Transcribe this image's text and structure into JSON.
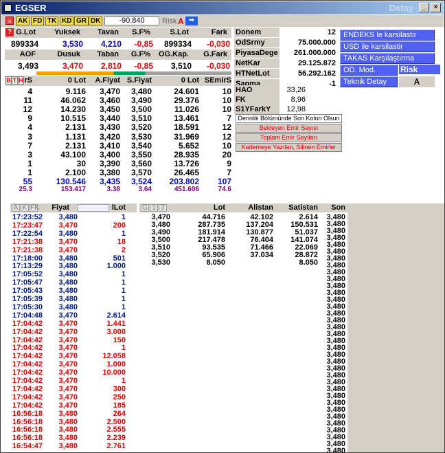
{
  "title": "EGSER",
  "title_right": "Detay",
  "toolbar": {
    "tags": [
      "AK",
      "FD",
      "TK",
      "KD",
      "GR",
      "DK"
    ],
    "value": "-90.840",
    "risk_label": "Risk",
    "risk_value": "A"
  },
  "summary": {
    "h1": [
      "G.Lot",
      "Yuksek",
      "Tavan",
      "S.F%",
      "S.Lot",
      "Fark"
    ],
    "v1": [
      "899334",
      "3,530",
      "4,210",
      "-0,85",
      "899334",
      "-0,030"
    ],
    "h2": [
      "AOF",
      "Dusuk",
      "Taban",
      "G.F%",
      "OG.Kap.",
      "G.Fark"
    ],
    "v2": [
      "3,493",
      "3,470",
      "2,810",
      "-0,85",
      "3,510",
      "-0,030"
    ]
  },
  "depth_headers": [
    "rS",
    "0 Lot",
    "A.Fiyat",
    "S.Fiyat",
    "0 Lot",
    "SEmirS"
  ],
  "depth_tabs": [
    "B",
    "T",
    "H"
  ],
  "depth": [
    [
      "4",
      "9.116",
      "3,470",
      "3,480",
      "24.601",
      "10"
    ],
    [
      "11",
      "46.062",
      "3,460",
      "3,490",
      "29.376",
      "10"
    ],
    [
      "12",
      "14.230",
      "3,450",
      "3,500",
      "11.026",
      "10"
    ],
    [
      "9",
      "10.515",
      "3,440",
      "3,510",
      "13.461",
      "7"
    ],
    [
      "4",
      "2.131",
      "3,430",
      "3,520",
      "18.591",
      "12"
    ],
    [
      "3",
      "1.131",
      "3,420",
      "3,530",
      "31.969",
      "12"
    ],
    [
      "7",
      "2.131",
      "3,410",
      "3,540",
      "5.652",
      "10"
    ],
    [
      "3",
      "43.100",
      "3,400",
      "3,550",
      "28.935",
      "20"
    ],
    [
      "1",
      "30",
      "3,390",
      "3,560",
      "13.726",
      "9"
    ],
    [
      "1",
      "2.100",
      "3,380",
      "3,570",
      "26.465",
      "7"
    ]
  ],
  "depth_total": [
    "55",
    "130.546",
    "3,435",
    "3,524",
    "203.802",
    "107"
  ],
  "depth_avg": [
    "25.3",
    "153.417",
    "3.38",
    "3.64",
    "451.606",
    "74.6"
  ],
  "info": [
    [
      "Donem",
      "12"
    ],
    [
      "OdSrmy",
      "75.000.000"
    ],
    [
      "PiyasaDege",
      "261.000.000"
    ],
    [
      "NetKar",
      "29.125.872"
    ],
    [
      "HTNetLot",
      "56.292.162"
    ],
    [
      "Sapma",
      "-1"
    ]
  ],
  "info2": [
    [
      "HAO",
      "33,26"
    ],
    [
      "FK",
      "8,96"
    ],
    [
      "S1YFarkY",
      "12,98"
    ]
  ],
  "buttons": [
    "ENDEKS le karsilastir",
    "USD ile karsilastir",
    "TAKAS Karşılaştırma",
    "OD. Mod.",
    "Teknik Detay"
  ],
  "risk_kodu_label": "Risk Kodu",
  "risk_kodu_value": "A",
  "menu": [
    "Derinlik Bölümünde Son Kolon Olsun",
    "Bekleyen Emir Sayısı",
    "Toplam Emir Sayıları",
    "Kademeye Yazılan, Silinen Emirler"
  ],
  "trades_header": {
    "tabs": [
      "A",
      "K",
      "FK"
    ],
    "fiyat": "Fiyat",
    "lot": "lLot"
  },
  "trades": [
    [
      "17:23:52",
      "3,480",
      "1",
      "b"
    ],
    [
      "17:23:47",
      "3,470",
      "200",
      "r"
    ],
    [
      "17:22:54",
      "3,480",
      "1",
      "b"
    ],
    [
      "17:21:38",
      "3,470",
      "18",
      "r"
    ],
    [
      "17:21:38",
      "3,470",
      "2",
      "r"
    ],
    [
      "17:18:00",
      "3,480",
      "501",
      "b"
    ],
    [
      "17:13:29",
      "3,480",
      "1.000",
      "b"
    ],
    [
      "17:05:52",
      "3,480",
      "1",
      "b"
    ],
    [
      "17:05:47",
      "3,480",
      "1",
      "b"
    ],
    [
      "17:05:43",
      "3,480",
      "1",
      "b"
    ],
    [
      "17:05:39",
      "3,480",
      "1",
      "b"
    ],
    [
      "17:05:30",
      "3,480",
      "1",
      "b"
    ],
    [
      "17:04:48",
      "3,470",
      "2.614",
      "b"
    ],
    [
      "17:04:42",
      "3,470",
      "1.441",
      "r"
    ],
    [
      "17:04:42",
      "3,470",
      "3.000",
      "r"
    ],
    [
      "17:04:42",
      "3,470",
      "150",
      "r"
    ],
    [
      "17:04:42",
      "3,470",
      "1",
      "r"
    ],
    [
      "17:04:42",
      "3,470",
      "12.058",
      "r"
    ],
    [
      "17:04:42",
      "3,470",
      "1.000",
      "r"
    ],
    [
      "17:04:42",
      "3,470",
      "10.000",
      "r"
    ],
    [
      "17:04:42",
      "3,470",
      "1",
      "r"
    ],
    [
      "17:04:42",
      "3,470",
      "300",
      "r"
    ],
    [
      "17:04:42",
      "3,470",
      "250",
      "r"
    ],
    [
      "17:04:42",
      "3,470",
      "185",
      "r"
    ],
    [
      "16:56:18",
      "3,480",
      "264",
      "r"
    ],
    [
      "16:56:18",
      "3,480",
      "2.500",
      "r"
    ],
    [
      "16:56:18",
      "3,480",
      "2.555",
      "r"
    ],
    [
      "16:56:18",
      "3,480",
      "2.239",
      "r"
    ],
    [
      "16:54:47",
      "3,480",
      "2.761",
      "r"
    ]
  ],
  "dist_header": {
    "tabs": [
      "G",
      "1",
      "2"
    ],
    "lot": "Lot",
    "alistan": "Alistan",
    "satistan": "Satistan",
    "son": "Son"
  },
  "dist": [
    [
      "3,470",
      "44.716",
      "42.102",
      "2.614"
    ],
    [
      "3,480",
      "287.735",
      "137.204",
      "150.531"
    ],
    [
      "3,490",
      "181.914",
      "130.877",
      "51.037"
    ],
    [
      "3,500",
      "217.478",
      "76.404",
      "141.074"
    ],
    [
      "3,510",
      "93.535",
      "71.466",
      "22.069"
    ],
    [
      "3,520",
      "65.906",
      "37.034",
      "28.872"
    ],
    [
      "3,530",
      "8.050",
      "",
      "8.050"
    ]
  ],
  "son": [
    "3,480",
    "3,480",
    "3,480",
    "3,480",
    "3,480",
    "3,480",
    "3,480",
    "3,480",
    "3,480",
    "3,480",
    "3,480",
    "3,480",
    "3,480",
    "3,480",
    "3,480",
    "3,480",
    "3,480",
    "3,480",
    "3,480",
    "3,480",
    "3,480",
    "3,480",
    "3,480",
    "3,480",
    "3,480",
    "3,480",
    "3,480",
    "3,480",
    "3,480",
    "3,480",
    "3,480",
    "3,480",
    "3,480",
    "3,480",
    "3,480",
    "3,480"
  ]
}
